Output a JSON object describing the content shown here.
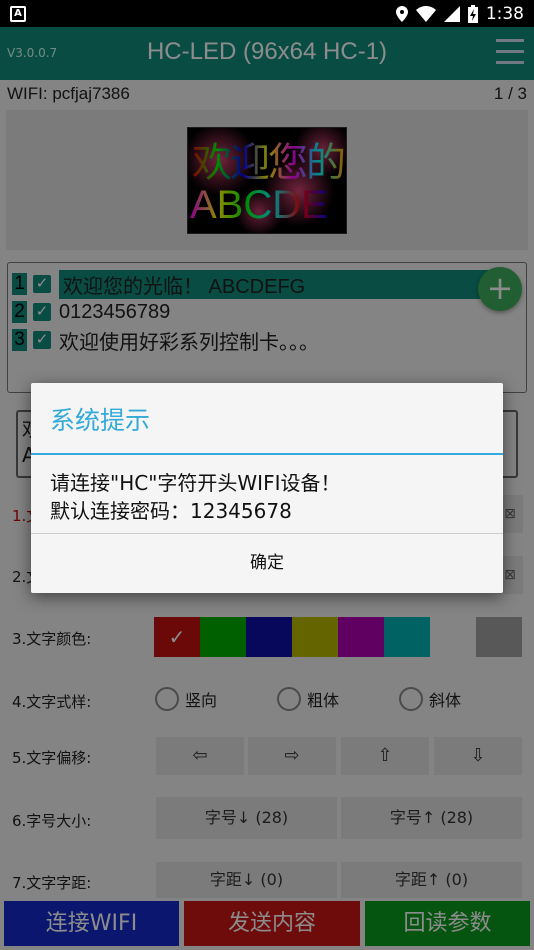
{
  "status_bar": {
    "time": "1:38",
    "notification_icon": "A"
  },
  "app_bar": {
    "version": "V3.0.0.7",
    "title": "HC-LED (96x64 HC-1)"
  },
  "wifi": {
    "ssid_label": "WIFI: pcfjaj7386",
    "page_indicator": "1 / 3"
  },
  "preview": {
    "line1": "欢迎您的",
    "line2": "ABCDE"
  },
  "programs": [
    {
      "num": "1",
      "check": "✓",
      "text": "欢迎您的光临！ ABCDEFG",
      "selected": true
    },
    {
      "num": "2",
      "check": "✓",
      "text": "0123456789",
      "selected": false
    },
    {
      "num": "3",
      "check": "✓",
      "text": "欢迎使用好彩系列控制卡。。。",
      "selected": false
    }
  ],
  "fab_label": "+",
  "edit_box": {
    "line1": "欢",
    "line2": "A"
  },
  "form": {
    "row1_label": "1.文",
    "row2_label": "2.文",
    "side_glyph": "⊠",
    "color_label": "3.文字颜色:",
    "colors": [
      "#c41212",
      "#00b000",
      "#0d0da8",
      "#b8b800",
      "#b000b0",
      "#00b3b3",
      "#f0f0f0",
      "#a0a0a0"
    ],
    "color_check": "✓",
    "style_label": "4.文字式样:",
    "styles": [
      "竖向",
      "粗体",
      "斜体"
    ],
    "offset_label": "5.文字偏移:",
    "offset_buttons": [
      "⇦",
      "⇨",
      "⇧",
      "⇩"
    ],
    "size_label": "6.字号大小:",
    "size_down": "字号↓ (28)",
    "size_up": "字号↑ (28)",
    "spacing_label": "7.文字字距:",
    "spacing_down": "字距↓ (0)",
    "spacing_up": "字距↑ (0)"
  },
  "bottom": {
    "connect": "连接WIFI",
    "send": "发送内容",
    "read": "回读参数",
    "colors": {
      "connect": "#1428c8",
      "send": "#c81414",
      "read": "#0a9a1e"
    }
  },
  "dialog": {
    "title": "系统提示",
    "message_line1": "请连接\"HC\"字符开头WIFI设备！",
    "message_line2": "默认连接密码：12345678",
    "ok": "确定"
  }
}
